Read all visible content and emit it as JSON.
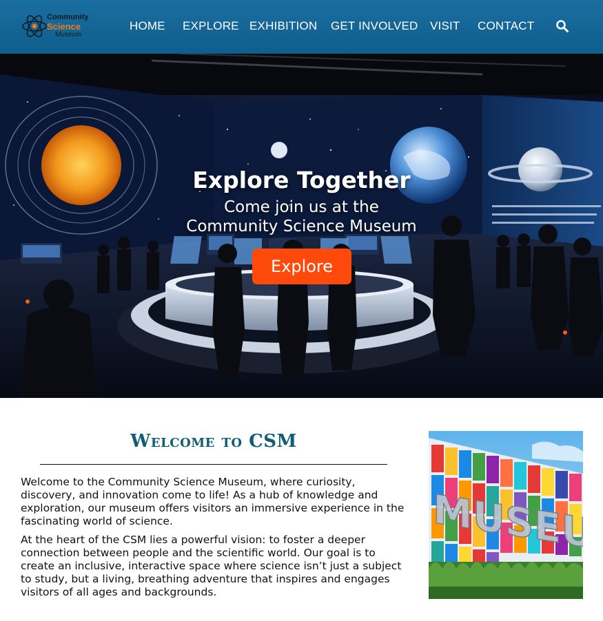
{
  "header": {
    "logo": {
      "line1": "Community",
      "line2": "Science",
      "line3": "Museum",
      "icon": "atom-icon"
    },
    "nav": [
      {
        "label": "HOME"
      },
      {
        "label": "EXPLORE"
      },
      {
        "label": "EXHIBITION"
      },
      {
        "label": "GET INVOLVED"
      },
      {
        "label": "VISIT"
      },
      {
        "label": "CONTACT"
      }
    ],
    "search_icon": "search-icon"
  },
  "hero": {
    "title": "Explore Together",
    "subtitle_line1": "Come join us at the",
    "subtitle_line2": "Community Science Museum",
    "button_label": "Explore",
    "button_color": "#ff4a0b"
  },
  "welcome": {
    "title": "Welcome to CSM",
    "paragraph1": "Welcome to the Community Science Museum, where curiosity, discovery, and innovation come to life! As a hub of knowledge and exploration, our museum offers visitors an immersive experience in the fascinating world of science.",
    "paragraph2": "At the heart of the CSM lies a powerful vision: to foster a deeper connection between people and the scientific world. Our goal is to create an inclusive, interactive space where science isn’t just a subject to study, but a living, breathing adventure that inspires and engages visitors of all ages and backgrounds.",
    "image_text": "MUSEUM"
  },
  "colors": {
    "header_bg": "#1a6fa0",
    "accent_orange": "#ff4a0b",
    "title_teal": "#0f5d74"
  }
}
